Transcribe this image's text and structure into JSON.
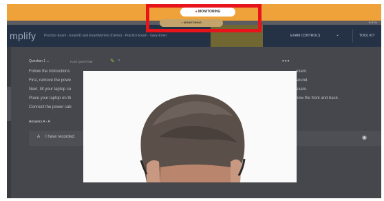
{
  "topbar": {
    "right_text": "⊕ 87%"
  },
  "monitor": {
    "label": "MONITORING",
    "label_secondary": "MONITORING"
  },
  "nav": {
    "brand": "mplify",
    "title": "Practice Exam - ExamID and ExamMonitor (Demo)  ·  Practice Exam  ·  Gary Emer",
    "exam_controls": "EXAM CONTROLS",
    "tool_kit": "TOOL KIT"
  },
  "question": {
    "header": "Question 1",
    "flag": "FLAG QUESTION",
    "more": "•••",
    "lines": [
      "Follow the instructions",
      "First, remove the powe",
      "Next, tilt your laptop so",
      "Place your laptop on th",
      "Connect the power cab"
    ],
    "lines_right": [
      "exam.",
      "sound.",
      "exam.",
      "how the front and back."
    ],
    "answers_label": "Answers A - A",
    "answer_letter": "A",
    "answer_text": "I have recorded"
  },
  "icons": {
    "flag": "pencil-icon",
    "more": "more-icon",
    "eye": "eye-icon",
    "chevron": "chevron-down-icon"
  },
  "colors": {
    "accent": "#f0a23a",
    "navbar": "#253246",
    "highlight_box": "#e8141b",
    "monitoring_dot": "#d0342c"
  }
}
